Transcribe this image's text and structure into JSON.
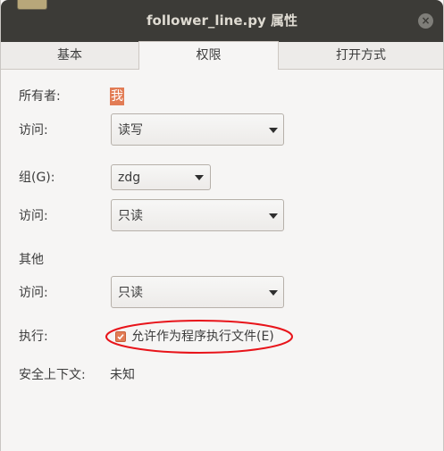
{
  "window": {
    "title": "follower_line.py 属性",
    "close_glyph": "×"
  },
  "tabs": [
    {
      "label": "基本",
      "active": false
    },
    {
      "label": "权限",
      "active": true
    },
    {
      "label": "打开方式",
      "active": false
    }
  ],
  "owner": {
    "label": "所有者:",
    "value": "我",
    "access_label": "访问:",
    "access_value": "读写"
  },
  "group": {
    "label": "组(G):",
    "value": "zdg",
    "access_label": "访问:",
    "access_value": "只读"
  },
  "others": {
    "label": "其他",
    "access_label": "访问:",
    "access_value": "只读"
  },
  "execute": {
    "label": "执行:",
    "checkbox_label": "允许作为程序执行文件(E)",
    "checked": true
  },
  "security": {
    "label": "安全上下文:",
    "value": "未知"
  },
  "colors": {
    "accent": "#e27c55",
    "titlebar": "#3c3b37",
    "annotation": "#e8141a"
  },
  "icons": {
    "close": "close-icon",
    "dropdown": "chevron-down-icon",
    "check": "check-icon"
  }
}
